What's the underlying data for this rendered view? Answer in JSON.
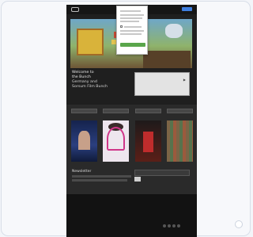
{
  "site": {
    "brand": "",
    "nav_links": [
      "",
      "",
      ""
    ]
  },
  "welcome": {
    "line1": "Welcome to",
    "line2": "the Bunch",
    "line3": "Germany and",
    "line4": "Sorsum Film Bunch"
  },
  "buttons": [
    "",
    "",
    "",
    ""
  ],
  "newsletter": {
    "label": "Newsletter"
  },
  "popup": {
    "ok_label": "",
    "no_label": ""
  },
  "colors": {
    "accent": "#3f7fe0",
    "popup_ok": "#5aa64b",
    "page_bg": "#1f1f1f"
  }
}
